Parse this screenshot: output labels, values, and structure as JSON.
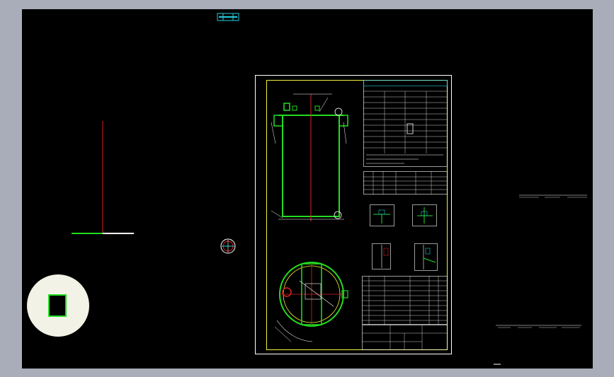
{
  "app": {
    "title": "",
    "colors": {
      "background": "#a9adb9",
      "canvas": "#000000",
      "sheet_border": "#ffffff",
      "inner_frame": "#f2f23a",
      "vessel": "#22dd22",
      "centerline": "#dd2222",
      "cyan": "#22ccdd",
      "text": "#ffffff",
      "compass": "#f2f2e6"
    }
  },
  "canvas": {
    "ucs_icon": "ucs-axis-icon",
    "nav_widget": "navigation-compass-icon",
    "top_marker": "cyan-block-icon",
    "left_marker": "circle-symbol-icon"
  },
  "drawing": {
    "table_title": "",
    "notes": "",
    "detail_labels": [
      "",
      "",
      "",
      ""
    ],
    "title_block": ""
  },
  "side_notes": {
    "right_upper": "",
    "right_lower": "",
    "bottom_tag": ""
  }
}
